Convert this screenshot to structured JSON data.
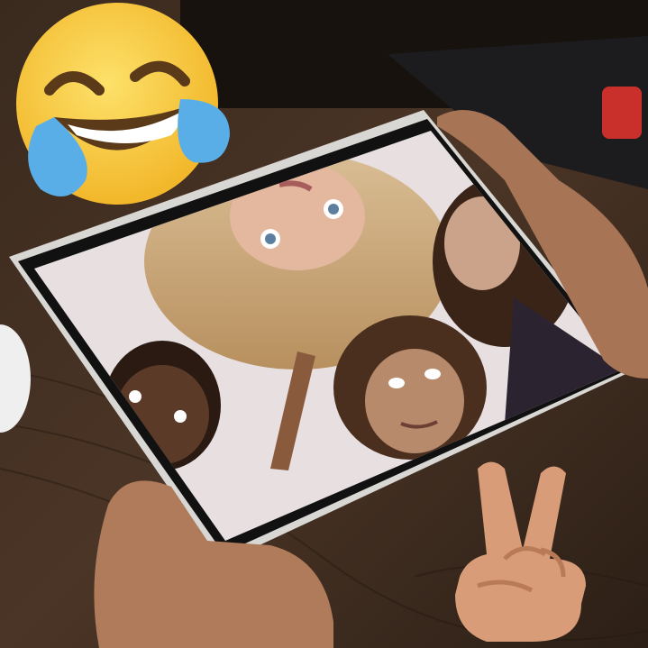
{
  "scene": {
    "description_hidden": "",
    "colors": {
      "table": "#4a3527",
      "table_dark": "#2b1e15",
      "tablet_frame": "#d9d7d4",
      "screen_bezel": "#111111",
      "screen_bg": "#e8dfe0",
      "skin_light": "#b98361",
      "emoji_yellow": "#f6c93c",
      "emoji_tear": "#5aaee8",
      "peace_skin": "#d99c78"
    }
  },
  "stickers": {
    "top_left": {
      "icon": "face-with-tears-of-joy-icon"
    },
    "bottom_right": {
      "icon": "victory-hand-icon"
    }
  }
}
